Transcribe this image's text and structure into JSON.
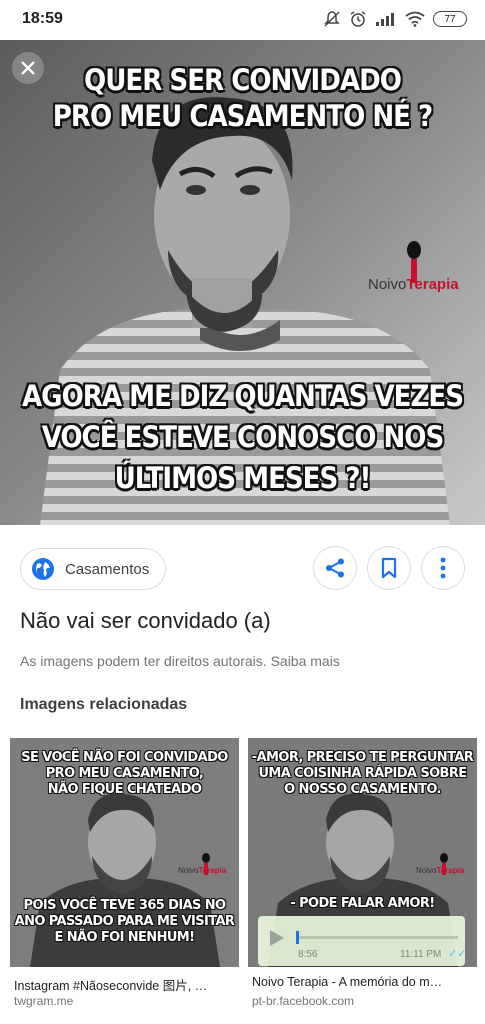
{
  "status_bar": {
    "time": "18:59",
    "battery": "77"
  },
  "hero": {
    "top_text": [
      "QUER SER CONVIDADO",
      "PRO MEU CASAMENTO NÉ ?"
    ],
    "bottom_text": [
      "AGORA ME DIZ QUANTAS VEZES",
      "VOCÊ ESTEVE CONOSCO NOS",
      "ÚLTIMOS MESES ?!"
    ],
    "brand_prefix": "Noivo",
    "brand_suffix": "Terapia"
  },
  "chip": {
    "label": "Casamentos",
    "icon": "globe-icon"
  },
  "actions": [
    "share-icon",
    "bookmark-icon",
    "more-vert-icon"
  ],
  "title": "Não vai ser convidado (a)",
  "rights_notice": "As imagens podem ter direitos autorais. Saiba mais",
  "related": {
    "heading": "Imagens relacionadas",
    "items": [
      {
        "top_text": [
          "SE VOCÊ NÃO FOI CONVIDADO",
          "PRO MEU CASAMENTO,",
          "NÃO FIQUE CHATEADO"
        ],
        "bottom_text": [
          "POIS VOCÊ TEVE 365 DIAS NO",
          "ANO PASSADO PARA ME VISITAR",
          "E NÃO FOI NENHUM!"
        ],
        "brand_prefix": "Noivo",
        "brand_suffix": "Terapia",
        "caption": "Instagram #Nãoseconvide 图片, …",
        "source": "twgram.me"
      },
      {
        "top_text": [
          "-AMOR, PRECISO TE PERGUNTAR",
          "UMA COISINHA RÁPIDA SOBRE",
          "O NOSSO CASAMENTO."
        ],
        "bottom_text": [
          "- PODE FALAR AMOR!"
        ],
        "brand_prefix": "Noivo",
        "brand_suffix": "Terapia",
        "audio_duration": "8:56",
        "audio_time": "11:11 PM",
        "caption": "Noivo Terapia - A memória do m…",
        "source": "pt-br.facebook.com"
      }
    ]
  },
  "colors": {
    "accent_blue": "#1a73e8",
    "brand_red": "#c8102e"
  }
}
